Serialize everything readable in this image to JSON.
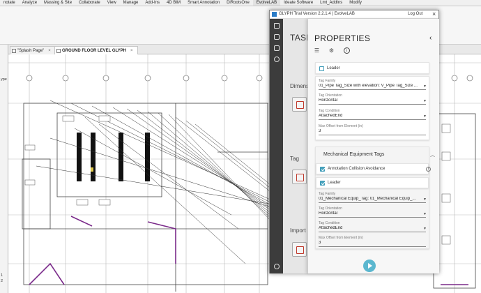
{
  "ribbon": {
    "tabs": [
      "notate",
      "Analyze",
      "Massing & Site",
      "Collaborate",
      "View",
      "Manage",
      "Add-Ins",
      "4D BIM",
      "Smart Annotation",
      "DiRootsOne",
      "EvolveLAB",
      "Ideate Software",
      "Lmt_AddIns",
      "Modify"
    ]
  },
  "view_tabs": [
    {
      "label": "\"Splash Page\"",
      "close": "×"
    },
    {
      "label": "GROUND FLOOR LEVEL GLYPH",
      "close": "×"
    }
  ],
  "left_strip": {
    "label_top": "ype",
    "label_bottom_1": "1",
    "label_bottom_2": "2"
  },
  "glyph": {
    "title": "GLYPH Trial Version 2.2.1.4 | EvolveLAB",
    "logout": "Log Out",
    "close": "×",
    "tasks_title": "TASKS",
    "task_sections": [
      "Dimensi",
      "Tag",
      "Import"
    ],
    "properties_title": "PROPERTIES",
    "back_chevron": "‹",
    "icons": [
      "checklist-icon",
      "gear-icon",
      "info-icon"
    ],
    "pipe_tags": {
      "leader_label": "Leader",
      "leader_checked": false,
      "tag_family_label": "Tag Family",
      "tag_family_value": "01_Pipe Tag_Size with elevation: V_Pipe Tag_Size ...",
      "tag_orientation_label": "Tag Orientation",
      "tag_orientation_value": "Horizontal",
      "tag_condition_label": "Tag Condition",
      "tag_condition_value": "AttachedEnd",
      "max_offset_label": "Max Offset from Element (in)",
      "max_offset_value": "3"
    },
    "mech_tags": {
      "title": "Mechanical Equipment Tags",
      "collision_label": "Annotation Collision Avoidance",
      "collision_checked": true,
      "leader_label": "Leader",
      "leader_checked": true,
      "tag_family_label": "Tag Family",
      "tag_family_value": "01_Mechanical Equip_Tag: 01_Mechanical Equip_...",
      "tag_orientation_label": "Tag Orientation",
      "tag_orientation_value": "Horizontal",
      "tag_condition_label": "Tag Condition",
      "tag_condition_value": "AttachedEnd",
      "max_offset_label": "Max Offset from Element (in)",
      "max_offset_value": "3"
    },
    "accent_color": "#4aa3bd"
  }
}
